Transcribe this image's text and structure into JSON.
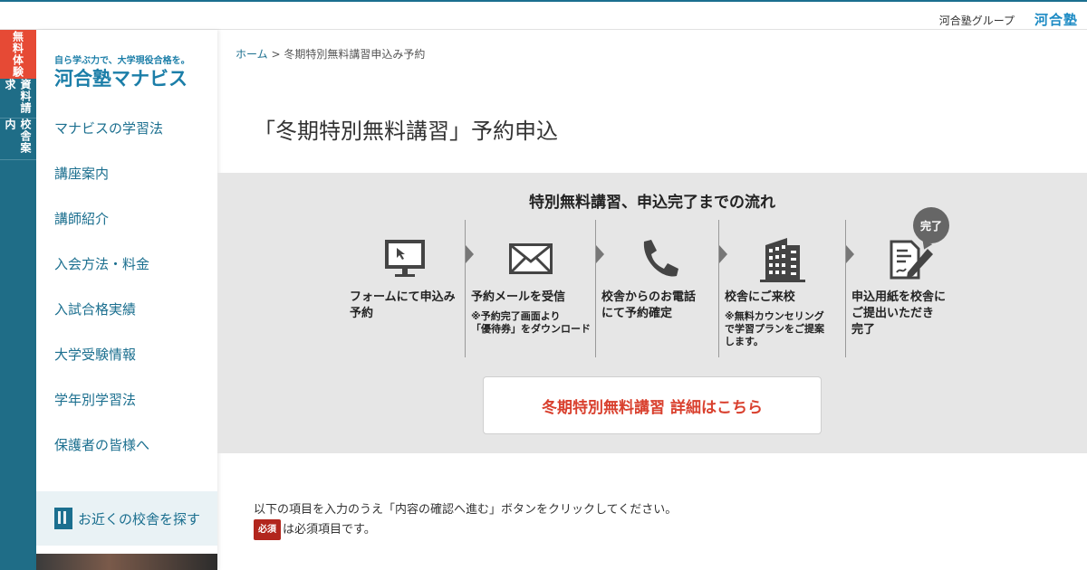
{
  "header": {
    "group_label": "河合塾グループ",
    "logo_text": "河合塾"
  },
  "side_tabs": [
    {
      "label": "無料体験"
    },
    {
      "label": "資料請求"
    },
    {
      "label": "校舎案内"
    }
  ],
  "sidebar": {
    "brand_tagline": "自ら学ぶ力で、大学現役合格を。",
    "brand_name": "河合塾マナビス",
    "items": [
      {
        "label": "マナビスの学習法"
      },
      {
        "label": "講座案内"
      },
      {
        "label": "講師紹介"
      },
      {
        "label": "入会方法・料金"
      },
      {
        "label": "入試合格実績"
      },
      {
        "label": "大学受験情報"
      },
      {
        "label": "学年別学習法"
      },
      {
        "label": "保護者の皆様へ"
      }
    ],
    "school_search_label": "お近くの校舎を探す"
  },
  "breadcrumb": {
    "home": "ホーム",
    "separator": ">",
    "current": "冬期特別無料講習申込み予約"
  },
  "page_title": "「冬期特別無料講習」予約申込",
  "flow": {
    "title": "特別無料講習、申込完了までの流れ",
    "done_badge": "完了",
    "steps": [
      {
        "icon": "computer-icon",
        "label_1": "フォームにて申込み",
        "label_2": "予約",
        "note_1": "",
        "note_2": "",
        "note_3": ""
      },
      {
        "icon": "mail-icon",
        "label_1": "予約メールを受信",
        "label_2": "",
        "note_1": "※予約完了画面より",
        "note_2": "「優待券」をダウンロード",
        "note_3": ""
      },
      {
        "icon": "phone-icon",
        "label_1": "校舎からのお電話",
        "label_2": "にて予約確定",
        "note_1": "",
        "note_2": "",
        "note_3": ""
      },
      {
        "icon": "building-icon",
        "label_1": "校舎にご来校",
        "label_2": "",
        "note_1": "※無料カウンセリング",
        "note_2": "で学習プランをご提案",
        "note_3": "します。"
      },
      {
        "icon": "document-pen-icon",
        "label_1": "申込用紙を校舎に",
        "label_2": "ご提出いただき",
        "label_3": "完了",
        "note_1": "",
        "note_2": "",
        "note_3": ""
      }
    ],
    "detail_button": "冬期特別無料講習 詳細はこちら"
  },
  "instructions": {
    "line1": "以下の項目を入力のうえ「内容の確認へ進む」ボタンをクリックしてください。",
    "required_badge": "必須",
    "line2": "は必須項目です。"
  },
  "colors": {
    "brand_teal": "#1f6d87",
    "accent_red": "#d9402e",
    "required_red": "#b2261d"
  }
}
